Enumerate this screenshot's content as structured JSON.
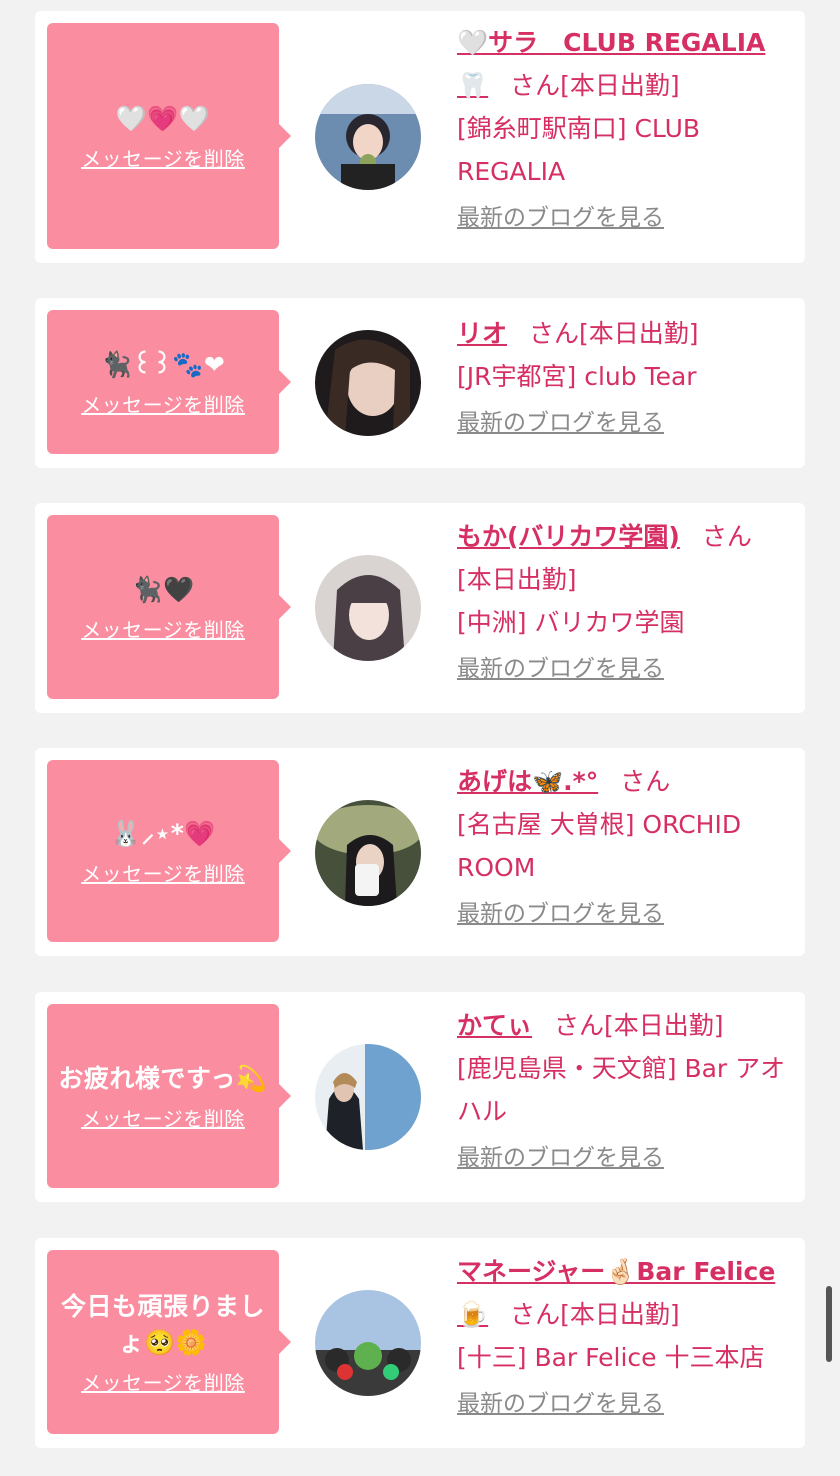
{
  "delete_label": "メッセージを削除",
  "blog_label": "最新のブログを見る",
  "san": "さん",
  "cards": [
    {
      "message": "🤍💗🤍",
      "name": "🤍サラ　CLUB REGALIA 🦷",
      "status": "[本日出勤]",
      "location": "[錦糸町駅南口] CLUB REGALIA"
    },
    {
      "message": "🐈‍⬛꒰꒱🐾❤",
      "name": "リオ",
      "status": "[本日出勤]",
      "location": "[JR宇都宮] club Tear"
    },
    {
      "message": "🐈‍⬛🖤",
      "name": "もか(バリカワ学園)",
      "status": "[本日出勤]",
      "location": "[中洲] バリカワ学園"
    },
    {
      "message": "🐰⸝⋆*💗",
      "name": "あげは🦋.*°",
      "status": "",
      "location": "[名古屋 大曽根] ORCHID ROOM"
    },
    {
      "message": "お疲れ様ですっ💫",
      "name": "かてぃ",
      "status": "[本日出勤]",
      "location": "[鹿児島県・天文館] Bar アオハル"
    },
    {
      "message": "今日も頑張りましょ🥺🌼",
      "name": "マネージャー🤞🏻Bar Felice🍺",
      "status": "[本日出勤]",
      "location": "[十三] Bar Felice 十三本店"
    }
  ]
}
